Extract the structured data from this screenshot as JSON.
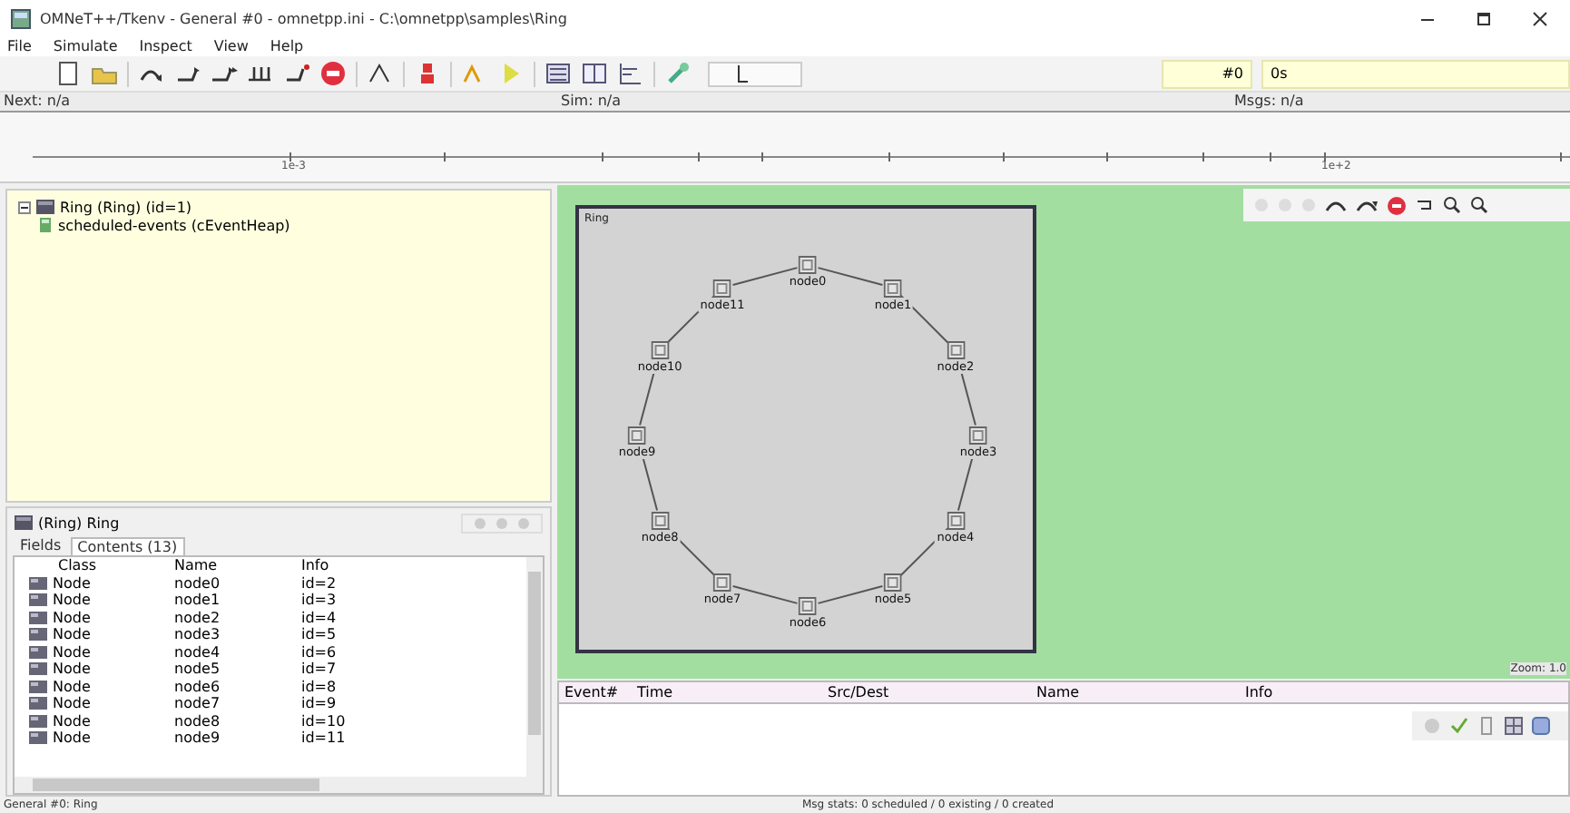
{
  "window": {
    "title": "OMNeT++/Tkenv - General #0 - omnetpp.ini - C:\\omnetpp\\samples\\Ring"
  },
  "menu": [
    "File",
    "Simulate",
    "Inspect",
    "View",
    "Help"
  ],
  "speed_slider": {
    "level": 0.35
  },
  "counters": {
    "event": "#0",
    "time": "0s"
  },
  "info_labels": [
    "Next: n/a",
    "Sim: n/a",
    "Msgs: n/a"
  ],
  "timeline": {
    "tick_labels": [
      "1e-3",
      "1e+2"
    ]
  },
  "tree": [
    {
      "label": "Ring (Ring) (id=1)",
      "expanded": true,
      "children": [
        {
          "label": "scheduled-events (cEventHeap)"
        }
      ]
    }
  ],
  "inspector": {
    "title": "(Ring) Ring",
    "tabs": [
      {
        "label": "Fields",
        "selected": false
      },
      {
        "label": "Contents (13)",
        "selected": true
      }
    ],
    "columns": [
      "Class",
      "Name",
      "Info"
    ],
    "rows": [
      {
        "class": "Node",
        "name": "node0",
        "info": "id=2"
      },
      {
        "class": "Node",
        "name": "node1",
        "info": "id=3"
      },
      {
        "class": "Node",
        "name": "node2",
        "info": "id=4"
      },
      {
        "class": "Node",
        "name": "node3",
        "info": "id=5"
      },
      {
        "class": "Node",
        "name": "node4",
        "info": "id=6"
      },
      {
        "class": "Node",
        "name": "node5",
        "info": "id=7"
      },
      {
        "class": "Node",
        "name": "node6",
        "info": "id=8"
      },
      {
        "class": "Node",
        "name": "node7",
        "info": "id=9"
      },
      {
        "class": "Node",
        "name": "node8",
        "info": "id=10"
      },
      {
        "class": "Node",
        "name": "node9",
        "info": "id=11"
      }
    ]
  },
  "canvas": {
    "module_label": "Ring",
    "zoom": "Zoom: 1.0",
    "nodes": [
      "node0",
      "node1",
      "node2",
      "node3",
      "node4",
      "node5",
      "node6",
      "node7",
      "node8",
      "node9",
      "node10",
      "node11"
    ]
  },
  "log": {
    "columns": [
      "Event#",
      "Time",
      "Src/Dest",
      "Name",
      "Info"
    ]
  },
  "status_bar": [
    "General #0: Ring",
    "Msg stats: 0 scheduled / 0 existing / 0 created"
  ]
}
